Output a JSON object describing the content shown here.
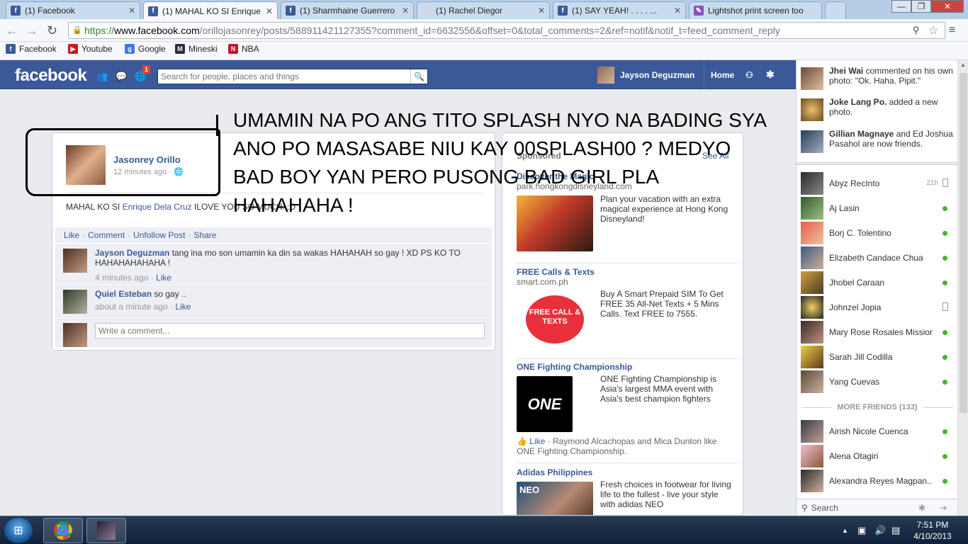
{
  "browser": {
    "tabs": [
      {
        "title": "(1) Facebook",
        "favicon": "f",
        "color": "#3b5998"
      },
      {
        "title": "(1) MAHAL KO SI Enrique...",
        "favicon": "f",
        "color": "#3b5998"
      },
      {
        "title": "(1) Sharmhaine Guerrero",
        "favicon": "f",
        "color": "#3b5998"
      },
      {
        "title": "(1) Rachel Diegor",
        "favicon": "",
        "color": "#cfd8e3"
      },
      {
        "title": "(1) SAY YEAH! . . . . ...",
        "favicon": "f",
        "color": "#3b5998"
      },
      {
        "title": "Lightshot print screen too",
        "favicon": "✎",
        "color": "#8a4fc0"
      }
    ],
    "url": {
      "https": "https://",
      "host": "www.facebook.com",
      "path": "/orillojasonrey/posts/588911421127355?comment_id=6632556&offset=0&total_comments=2&ref=notif&notif_t=feed_comment_reply"
    },
    "bookmarks": [
      {
        "label": "Facebook",
        "icon": "f",
        "color": "#3b5998"
      },
      {
        "label": "Youtube",
        "icon": "▶",
        "color": "#cc181e"
      },
      {
        "label": "Google",
        "icon": "g",
        "color": "#3f79e0"
      },
      {
        "label": "Mineski",
        "icon": "M",
        "color": "#2a2f3a"
      },
      {
        "label": "NBA",
        "icon": "N",
        "color": "#c8102e"
      }
    ]
  },
  "facebook": {
    "logo": "facebook",
    "notif_count": "1",
    "search_placeholder": "Search for people, places and things",
    "user_name": "Jayson Deguzman",
    "home_label": "Home"
  },
  "post": {
    "author": "Jasonrey Orillo",
    "time": "12 minutes ago ·",
    "text_before": "MAHAL KO SI ",
    "text_link": "Enrique Dela Cruz",
    "text_after": " ILOVE YOU SO MUCH. :D",
    "actions": [
      "Like",
      "Comment",
      "Unfollow Post",
      "Share"
    ],
    "comments": [
      {
        "author": "Jayson Deguzman",
        "text": " tang ina mo son umamin ka din sa wakas HAHAHAH so gay ! XD PS KO TO HAHAHAHAHAHA !",
        "time": "4 minutes ago · ",
        "like": "Like"
      },
      {
        "author": "Quiel Esteban",
        "text": " so gay ..",
        "time": "about a minute ago · ",
        "like": "Like"
      }
    ],
    "comment_placeholder": "Write a comment..."
  },
  "annotation": {
    "text": "UMAMIN NA PO ANG TITO SPLASH NYO NA BADING SYA ANO PO MASASABE NIU KAY 00SPLASH00 ? MEDYO BAD BOY YAN PERO PUSONG BAD GIRL PLA HAHAHAHA !"
  },
  "ads": {
    "header": "Sponsored",
    "see_all": "See All",
    "items": [
      {
        "title": "Discover the Magic",
        "url": "park.hongkongdisneyland.com",
        "body": "Plan your vacation with an extra magical experience at Hong Kong Disneyland!"
      },
      {
        "title": "FREE Calls & Texts",
        "url": "smart.com.ph",
        "body": "Buy A Smart Prepaid SIM To Get FREE 35 All-Net Texts + 5 Mins Calls. Text FREE to 7555.",
        "img_text": "FREE CALL & TEXTS"
      },
      {
        "title": "ONE Fighting Championship",
        "url": "",
        "body": "ONE Fighting Championship is Asia's largest MMA event with Asia's best champion fighters",
        "img_text": "ONE",
        "social_like": "Like",
        "social": " · Raymond Alcachopas and Mica Dunton like ONE Fighting Championship."
      },
      {
        "title": "Adidas Philippines",
        "url": "",
        "body": "Fresh choices in footwear for living life to the fullest - live your style with adidas NEO",
        "img_text": "NEO"
      }
    ]
  },
  "sidebar": {
    "ticker": [
      {
        "name": "Jhei Wai",
        "text": " commented on his own photo: \"Ok. Haha. Pipit.\""
      },
      {
        "name": "Joke Lang Po.",
        "text": " added a new photo."
      },
      {
        "name": "Gillian Magnaye",
        "text": " and Ed Joshua Pasahol are now friends."
      }
    ],
    "friends": [
      {
        "name": "Abyz RecInto",
        "status": "mobile",
        "idle": "21h"
      },
      {
        "name": "Aj Lasin",
        "status": "online"
      },
      {
        "name": "Borj C. Tolentino",
        "status": "online"
      },
      {
        "name": "Elizabeth Candace Chua",
        "status": "online"
      },
      {
        "name": "Jhobel Caraan",
        "status": "online"
      },
      {
        "name": "Johnzel Jopia",
        "status": "mobile"
      },
      {
        "name": "Mary Rose Rosales Mission",
        "status": "online"
      },
      {
        "name": "Sarah Jill Codilla",
        "status": "online"
      },
      {
        "name": "Yang Cuevas",
        "status": "online"
      }
    ],
    "more_friends": "MORE FRIENDS (133)",
    "more": [
      {
        "name": "Airish Nicole Cuenca",
        "status": "online"
      },
      {
        "name": "Alena Otagiri",
        "status": "online"
      },
      {
        "name": "Alexandra Reyes Magpan...",
        "status": "online"
      }
    ],
    "search_label": "Search"
  },
  "taskbar": {
    "time": "7:51 PM",
    "date": "4/10/2013"
  },
  "colors": {
    "fb_blue": "#3b5998",
    "online": "#42b72a"
  }
}
